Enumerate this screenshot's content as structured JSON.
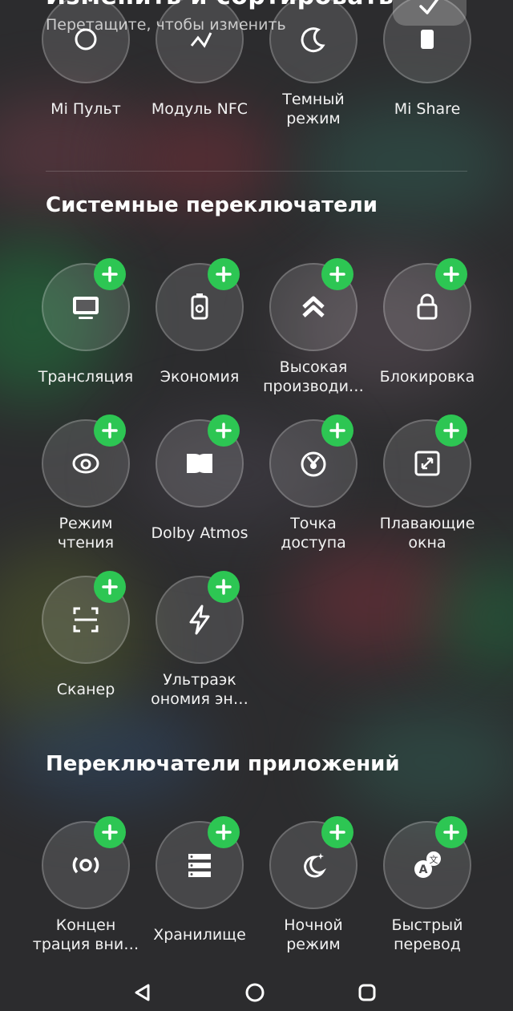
{
  "header": {
    "title": "Изменить и сортировать",
    "subtitle": "Перетащите, чтобы изменить",
    "done_icon": "checkmark-icon"
  },
  "current_tiles": [
    {
      "label": "Mi Пульт",
      "icon": "remote-icon"
    },
    {
      "label": "Модуль NFC",
      "icon": "nfc-icon"
    },
    {
      "label": "Темный\nрежим",
      "icon": "dark-mode-icon"
    },
    {
      "label": "Mi Share",
      "icon": "mi-share-icon"
    }
  ],
  "system_section": {
    "title": "Системные переключатели",
    "tiles": [
      {
        "label": "Трансляция",
        "icon": "cast-screen-icon"
      },
      {
        "label": "Экономия",
        "icon": "battery-saver-icon"
      },
      {
        "label": "Высокая\nпроизводи…",
        "icon": "performance-chevrons-icon"
      },
      {
        "label": "Блокировка",
        "icon": "lock-icon"
      },
      {
        "label": "Режим\nчтения",
        "icon": "reading-mode-eye-icon"
      },
      {
        "label": "Dolby Atmos",
        "icon": "dolby-icon"
      },
      {
        "label": "Точка\nдоступа",
        "icon": "hotspot-icon"
      },
      {
        "label": "Плавающие\nокна",
        "icon": "floating-window-icon"
      },
      {
        "label": "Сканер",
        "icon": "scanner-icon"
      },
      {
        "label": "Ультраэк\nономия эн…",
        "icon": "lightning-bolt-icon"
      }
    ]
  },
  "apps_section": {
    "title": "Переключатели приложений",
    "tiles": [
      {
        "label": "Концен\nтрация вни…",
        "icon": "focus-mode-icon"
      },
      {
        "label": "Хранилище",
        "icon": "storage-icon"
      },
      {
        "label": "Ночной\nрежим",
        "icon": "night-mode-icon"
      },
      {
        "label": "Быстрый\nперевод",
        "icon": "translate-icon"
      }
    ]
  },
  "add_icon": "plus-icon",
  "navbar": {
    "back": "back-triangle-icon",
    "home": "home-circle-icon",
    "recents": "recents-square-icon"
  },
  "colors": {
    "accent_green": "#2dc653",
    "tile_bg": "rgba(255,255,255,0.13)"
  }
}
